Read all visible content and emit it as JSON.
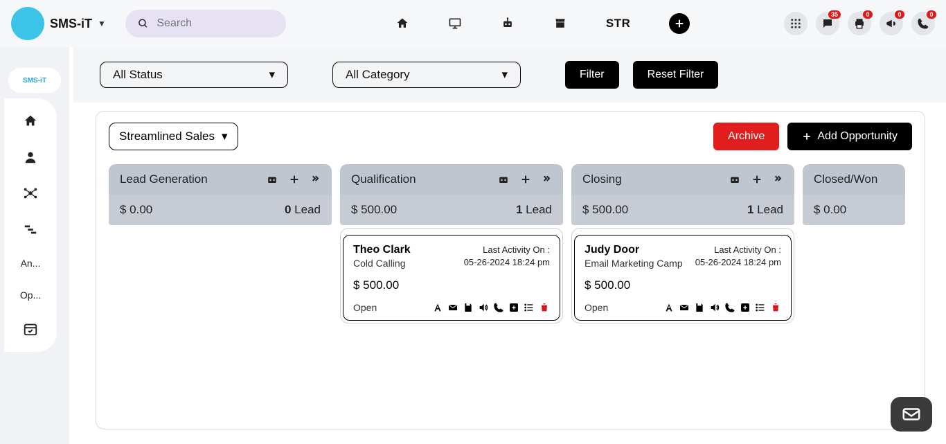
{
  "brand": {
    "name": "SMS-iT"
  },
  "search": {
    "placeholder": "Search"
  },
  "topnav": {
    "str": "STR"
  },
  "badges": {
    "chat": "35",
    "print": "0",
    "announce": "0",
    "phone": "0"
  },
  "sidebar": {
    "logo": "SMS-iT",
    "items": [
      {
        "label": "An..."
      },
      {
        "label": "Op..."
      }
    ]
  },
  "filters": {
    "status": "All Status",
    "category": "All Category",
    "filter_btn": "Filter",
    "reset_btn": "Reset Filter"
  },
  "board": {
    "pipeline": "Streamlined Sales",
    "archive": "Archive",
    "add_opp": "Add Opportunity",
    "columns": [
      {
        "title": "Lead Generation",
        "amount": "$ 0.00",
        "lead_count": "0",
        "lead_label": "Lead",
        "cards": []
      },
      {
        "title": "Qualification",
        "amount": "$ 500.00",
        "lead_count": "1",
        "lead_label": "Lead",
        "cards": [
          {
            "name": "Theo Clark",
            "source": "Cold Calling",
            "activity_label": "Last Activity On :",
            "activity_time": "05-26-2024 18:24 pm",
            "amount": "$ 500.00",
            "status": "Open"
          }
        ]
      },
      {
        "title": "Closing",
        "amount": "$ 500.00",
        "lead_count": "1",
        "lead_label": "Lead",
        "cards": [
          {
            "name": "Judy Door",
            "source": "Email Marketing Camp",
            "activity_label": "Last Activity On :",
            "activity_time": "05-26-2024 18:24 pm",
            "amount": "$ 500.00",
            "status": "Open"
          }
        ]
      },
      {
        "title": "Closed/Won",
        "amount": "$ 0.00",
        "lead_count": "",
        "lead_label": "",
        "cards": []
      }
    ]
  }
}
